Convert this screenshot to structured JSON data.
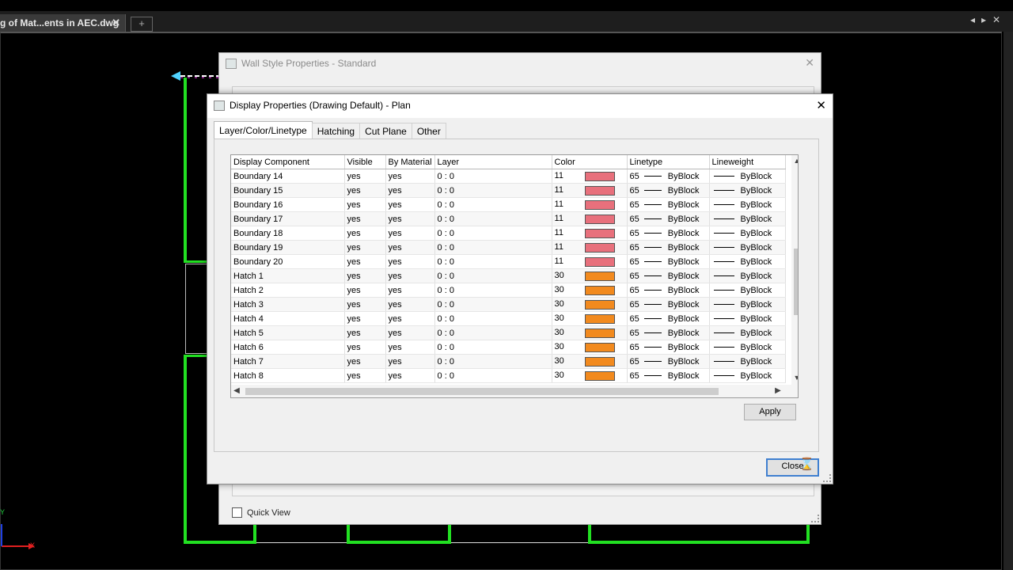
{
  "doc_tab": {
    "title": "g of Mat...ents in AEC.dwg",
    "close": "✕",
    "add": "+"
  },
  "nav": {
    "prev": "◂",
    "next": "▸",
    "close": "✕"
  },
  "back_dialog": {
    "title": "Wall Style Properties - Standard",
    "close": "✕",
    "quick_view_label": "Quick View"
  },
  "dialog": {
    "title": "Display Properties (Drawing Default) - Plan",
    "close": "✕",
    "tabs": [
      "Layer/Color/Linetype",
      "Hatching",
      "Cut Plane",
      "Other"
    ],
    "apply_label": "Apply",
    "close_label": "Close"
  },
  "grid": {
    "columns": [
      "Display Component",
      "Visible",
      "By Material",
      "Layer",
      "Color",
      "Linetype",
      "Lineweight"
    ],
    "rows": [
      {
        "component": "Boundary 14",
        "visible": "yes",
        "by_material": "yes",
        "layer": "0 : 0",
        "color_index": "11",
        "color_hex": "#e8707c",
        "linetype_num": "65",
        "linetype": "ByBlock",
        "lineweight": "ByBlock"
      },
      {
        "component": "Boundary 15",
        "visible": "yes",
        "by_material": "yes",
        "layer": "0 : 0",
        "color_index": "11",
        "color_hex": "#e8707c",
        "linetype_num": "65",
        "linetype": "ByBlock",
        "lineweight": "ByBlock"
      },
      {
        "component": "Boundary 16",
        "visible": "yes",
        "by_material": "yes",
        "layer": "0 : 0",
        "color_index": "11",
        "color_hex": "#e8707c",
        "linetype_num": "65",
        "linetype": "ByBlock",
        "lineweight": "ByBlock"
      },
      {
        "component": "Boundary 17",
        "visible": "yes",
        "by_material": "yes",
        "layer": "0 : 0",
        "color_index": "11",
        "color_hex": "#e8707c",
        "linetype_num": "65",
        "linetype": "ByBlock",
        "lineweight": "ByBlock"
      },
      {
        "component": "Boundary 18",
        "visible": "yes",
        "by_material": "yes",
        "layer": "0 : 0",
        "color_index": "11",
        "color_hex": "#e8707c",
        "linetype_num": "65",
        "linetype": "ByBlock",
        "lineweight": "ByBlock"
      },
      {
        "component": "Boundary 19",
        "visible": "yes",
        "by_material": "yes",
        "layer": "0 : 0",
        "color_index": "11",
        "color_hex": "#e8707c",
        "linetype_num": "65",
        "linetype": "ByBlock",
        "lineweight": "ByBlock"
      },
      {
        "component": "Boundary 20",
        "visible": "yes",
        "by_material": "yes",
        "layer": "0 : 0",
        "color_index": "11",
        "color_hex": "#e8707c",
        "linetype_num": "65",
        "linetype": "ByBlock",
        "lineweight": "ByBlock"
      },
      {
        "component": "Hatch 1",
        "visible": "yes",
        "by_material": "yes",
        "layer": "0 : 0",
        "color_index": "30",
        "color_hex": "#f28a1e",
        "linetype_num": "65",
        "linetype": "ByBlock",
        "lineweight": "ByBlock"
      },
      {
        "component": "Hatch 2",
        "visible": "yes",
        "by_material": "yes",
        "layer": "0 : 0",
        "color_index": "30",
        "color_hex": "#f28a1e",
        "linetype_num": "65",
        "linetype": "ByBlock",
        "lineweight": "ByBlock"
      },
      {
        "component": "Hatch 3",
        "visible": "yes",
        "by_material": "yes",
        "layer": "0 : 0",
        "color_index": "30",
        "color_hex": "#f28a1e",
        "linetype_num": "65",
        "linetype": "ByBlock",
        "lineweight": "ByBlock"
      },
      {
        "component": "Hatch 4",
        "visible": "yes",
        "by_material": "yes",
        "layer": "0 : 0",
        "color_index": "30",
        "color_hex": "#f28a1e",
        "linetype_num": "65",
        "linetype": "ByBlock",
        "lineweight": "ByBlock"
      },
      {
        "component": "Hatch 5",
        "visible": "yes",
        "by_material": "yes",
        "layer": "0 : 0",
        "color_index": "30",
        "color_hex": "#f28a1e",
        "linetype_num": "65",
        "linetype": "ByBlock",
        "lineweight": "ByBlock"
      },
      {
        "component": "Hatch 6",
        "visible": "yes",
        "by_material": "yes",
        "layer": "0 : 0",
        "color_index": "30",
        "color_hex": "#f28a1e",
        "linetype_num": "65",
        "linetype": "ByBlock",
        "lineweight": "ByBlock"
      },
      {
        "component": "Hatch 7",
        "visible": "yes",
        "by_material": "yes",
        "layer": "0 : 0",
        "color_index": "30",
        "color_hex": "#f28a1e",
        "linetype_num": "65",
        "linetype": "ByBlock",
        "lineweight": "ByBlock"
      },
      {
        "component": "Hatch 8",
        "visible": "yes",
        "by_material": "yes",
        "layer": "0 : 0",
        "color_index": "30",
        "color_hex": "#f28a1e",
        "linetype_num": "65",
        "linetype": "ByBlock",
        "lineweight": "ByBlock"
      }
    ]
  },
  "ucs": {
    "x_label": "X",
    "y_label": "Y"
  },
  "colors": {
    "wall_line": "#22e022",
    "canvas": "#000000",
    "dialog_bg": "#f0f0f0"
  }
}
